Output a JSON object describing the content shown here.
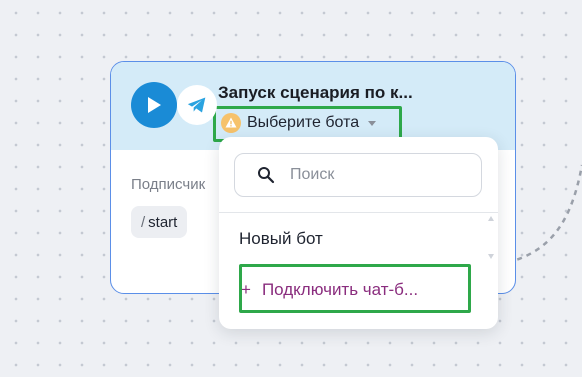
{
  "node": {
    "title": "Запуск сценария по к...",
    "bot_select_label": "Выберите бота",
    "subscriber_label": "Подписчик",
    "command": {
      "slash": "/",
      "text": "start"
    }
  },
  "dropdown": {
    "search_placeholder": "Поиск",
    "items": [
      {
        "label": "Новый бот"
      },
      {
        "plus": "+",
        "label": "Подключить чат-б..."
      }
    ]
  },
  "colors": {
    "play_button": "#1a8bd6",
    "header_bg": "#d4ebf8",
    "highlight": "#2ea84a",
    "connect_text": "#8a2d7e",
    "warning": "#f6c26b"
  },
  "icons": [
    "play-icon",
    "telegram-icon",
    "warning-icon",
    "chevron-down-icon",
    "search-icon",
    "plus-icon"
  ]
}
